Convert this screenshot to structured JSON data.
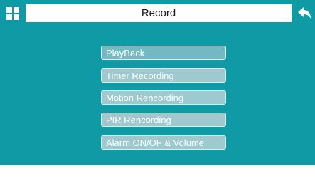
{
  "header": {
    "title": "Record",
    "menu_icon": "grid-icon",
    "back_icon": "back-arrow-icon"
  },
  "menu": {
    "items": [
      {
        "label": "PlayBack",
        "selected": true
      },
      {
        "label": "Timer Recording",
        "selected": false
      },
      {
        "label": "Motion Rencording",
        "selected": false
      },
      {
        "label": "PIR Rencording",
        "selected": false
      },
      {
        "label": "Alarm ON/OF & Volume",
        "selected": false
      }
    ]
  },
  "colors": {
    "background": "#0f9aa6",
    "item_fill": "#9ec9cf",
    "item_selected_fill": "#73b9c2",
    "text": "#ffffff"
  }
}
